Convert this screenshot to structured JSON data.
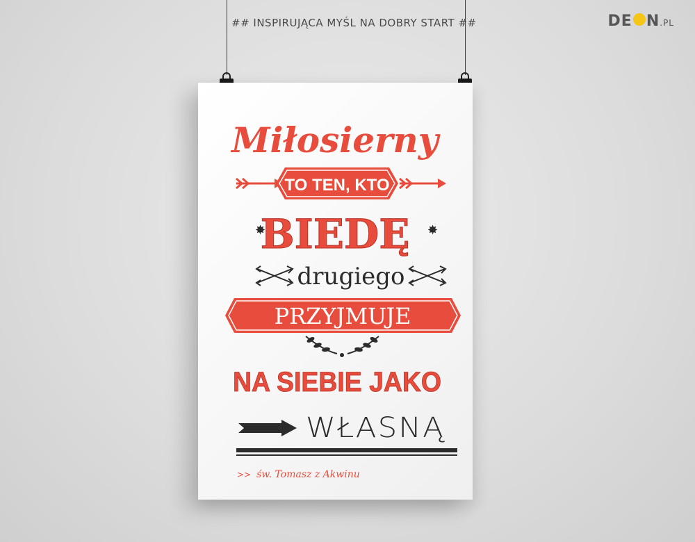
{
  "header": {
    "tagline": "## INSPIRUJĄCA MYŚL NA DOBRY START ##",
    "brand_prefix": "DE",
    "brand_suffix": "N",
    "brand_tld": ".PL"
  },
  "poster": {
    "line1": "Miłosierny",
    "line2": "TO TEN, KTO",
    "line3": "BIEDĘ",
    "line4": "drugiego",
    "line5": "PRZYJMUJE",
    "line6": "NA SIEBIE JAKO",
    "line7": "WŁASNĄ",
    "author_prefix": ">>",
    "author": "św. Tomasz z Akwinu"
  },
  "colors": {
    "accent": "#e74c3c",
    "dark": "#2b2b2b",
    "brand_dot": "#f5c518"
  }
}
